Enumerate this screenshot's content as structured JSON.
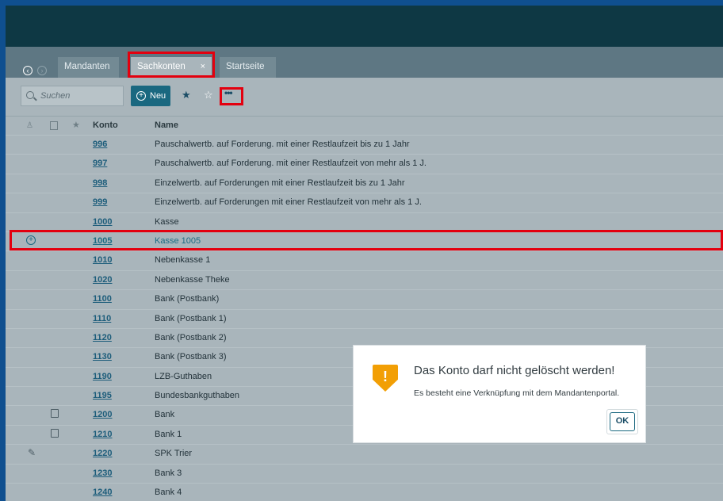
{
  "tabs": [
    {
      "label": "Mandanten"
    },
    {
      "label": "Sachkonten",
      "close": "×"
    },
    {
      "label": "Startseite"
    }
  ],
  "toolbar": {
    "search_placeholder": "Suchen",
    "new_label": "Neu",
    "more_label": "•••"
  },
  "table": {
    "headers": {
      "konto": "Konto",
      "name": "Name"
    },
    "rows": [
      {
        "konto": "996",
        "name": "Pauschalwertb. auf Forderung. mit einer Restlaufzeit bis zu 1 Jahr"
      },
      {
        "konto": "997",
        "name": "Pauschalwertb. auf Forderung. mit einer Restlaufzeit von mehr als 1 J."
      },
      {
        "konto": "998",
        "name": "Einzelwertb. auf Forderungen mit einer Restlaufzeit bis zu 1 Jahr"
      },
      {
        "konto": "999",
        "name": "Einzelwertb. auf Forderungen mit einer Restlaufzeit von mehr als 1 J."
      },
      {
        "konto": "1000",
        "name": "Kasse"
      },
      {
        "konto": "1005",
        "name": "Kasse 1005",
        "selected": true
      },
      {
        "konto": "1010",
        "name": "Nebenkasse 1"
      },
      {
        "konto": "1020",
        "name": "Nebenkasse Theke"
      },
      {
        "konto": "1100",
        "name": "Bank (Postbank)"
      },
      {
        "konto": "1110",
        "name": "Bank (Postbank 1)"
      },
      {
        "konto": "1120",
        "name": "Bank (Postbank 2)"
      },
      {
        "konto": "1130",
        "name": "Bank (Postbank 3)"
      },
      {
        "konto": "1190",
        "name": "LZB-Guthaben"
      },
      {
        "konto": "1195",
        "name": "Bundesbankguthaben"
      },
      {
        "konto": "1200",
        "name": "Bank"
      },
      {
        "konto": "1210",
        "name": "Bank 1"
      },
      {
        "konto": "1220",
        "name": "SPK Trier"
      },
      {
        "konto": "1230",
        "name": "Bank 3"
      },
      {
        "konto": "1240",
        "name": "Bank 4"
      }
    ]
  },
  "dialog": {
    "title": "Das Konto darf nicht gelöscht werden!",
    "message": "Es besteht eine Verknüpfung mit dem Mandantenportal.",
    "ok_label": "OK",
    "icon": "warning-shield-icon",
    "accent": "#f29f05"
  },
  "colors": {
    "topbar": "#0e3844",
    "primary": "#1a6880",
    "highlight": "#e3000f"
  }
}
